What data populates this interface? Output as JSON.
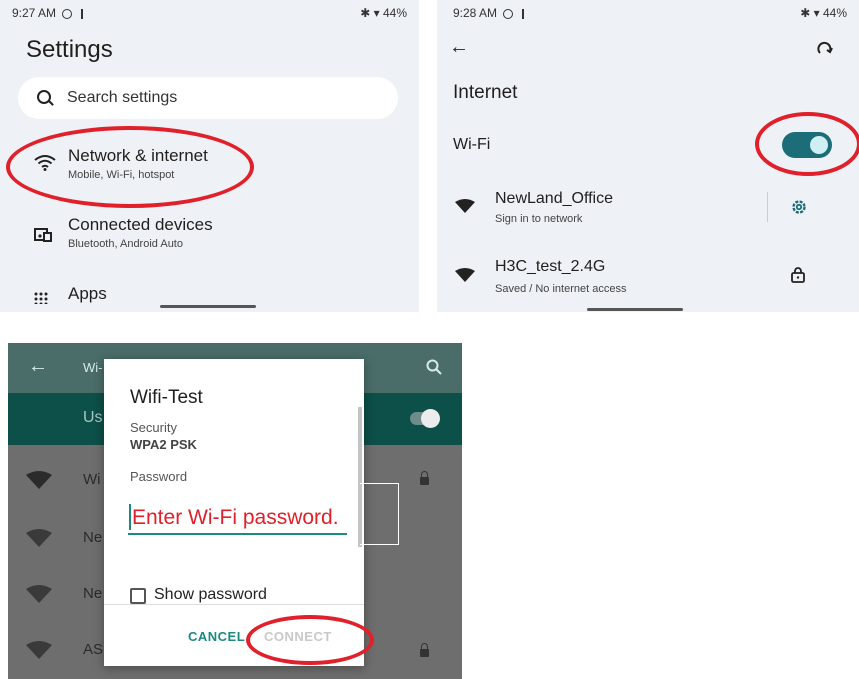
{
  "panel1": {
    "time": "9:27 AM",
    "battery": "44%",
    "title": "Settings",
    "search_placeholder": "Search settings",
    "items": [
      {
        "title": "Network & internet",
        "subtitle": "Mobile, Wi-Fi, hotspot",
        "icon": "wifi-icon"
      },
      {
        "title": "Connected devices",
        "subtitle": "Bluetooth, Android Auto",
        "icon": "devices-icon"
      },
      {
        "title": "Apps",
        "subtitle": "",
        "icon": "apps-grid-icon"
      }
    ]
  },
  "panel2": {
    "time": "9:28 AM",
    "battery": "44%",
    "title": "Internet",
    "wifi_label": "Wi-Fi",
    "wifi_enabled": true,
    "networks": [
      {
        "name": "NewLand_Office",
        "status": "Sign in to network",
        "action_icon": "gear-icon"
      },
      {
        "name": "H3C_test_2.4G",
        "status": "Saved / No internet access",
        "action_icon": "lock-icon"
      }
    ]
  },
  "panel3": {
    "background_rows": [
      "Wi",
      "Ne",
      "Ne",
      "AS"
    ],
    "appbar_title": "Wi-",
    "band_text": "Us",
    "dialog": {
      "title": "Wifi-Test",
      "security_label": "Security",
      "security_value": "WPA2 PSK",
      "password_label": "Password",
      "password_placeholder": "Enter Wi-Fi password.",
      "show_password_label": "Show password",
      "cancel_label": "CANCEL",
      "connect_label": "CONNECT"
    }
  },
  "colors": {
    "accent_teal": "#1c8a80",
    "toggle_on": "#1c6d77",
    "highlight_red": "#e0202a",
    "panel_bg": "#eef1f5"
  }
}
